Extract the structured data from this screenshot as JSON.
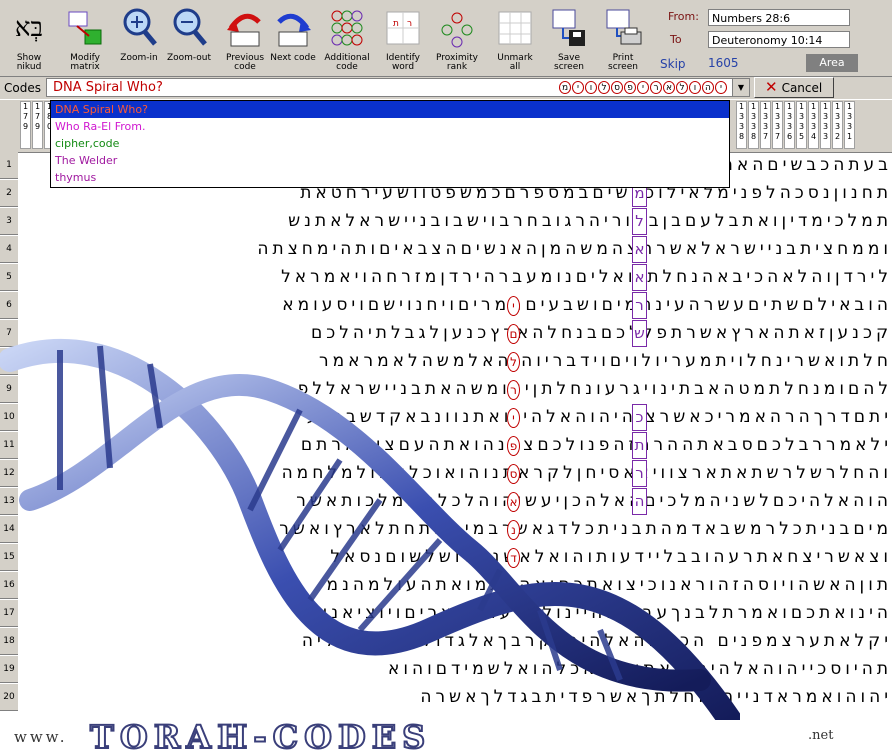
{
  "toolbar": {
    "buttons": [
      {
        "label": "Show nikud",
        "icon": "hebrew-bet-aleph-icon"
      },
      {
        "label": "Modify matrix",
        "icon": "matrix-grid-icon"
      },
      {
        "label": "Zoom-in",
        "icon": "zoom-in-icon"
      },
      {
        "label": "Zoom-out",
        "icon": "zoom-out-icon"
      },
      {
        "label": "Previous code",
        "icon": "previous-arrow-icon"
      },
      {
        "label": "Next code",
        "icon": "next-arrow-icon"
      },
      {
        "label": "Additional code",
        "icon": "additional-code-icon"
      },
      {
        "label": "Identify word",
        "icon": "identify-word-icon"
      },
      {
        "label": "Proximity rank",
        "icon": "proximity-rank-icon"
      },
      {
        "label": "Unmark all",
        "icon": "unmark-icon"
      },
      {
        "label": "Save screen",
        "icon": "floppy-disk-icon"
      },
      {
        "label": "Print screen",
        "icon": "printer-icon"
      }
    ],
    "bet_aleph": "בְּא",
    "range": {
      "from_label": "From:",
      "from_value": "Numbers 28:6",
      "to_label": "To",
      "to_value": "Deuteronomy 10:14"
    },
    "skip_label": "Skip",
    "skip_value": "1605",
    "area_label": "Area"
  },
  "codes": {
    "label": "Codes :",
    "selected": "DNA Spiral Who?",
    "oval_letters": [
      "מ",
      "י",
      "ו",
      "ל",
      "ס",
      "פ",
      "י",
      "ר",
      "א",
      "ל",
      "ו",
      "ה",
      "י"
    ],
    "cancel_label": "Cancel",
    "dropdown": [
      {
        "text": "DNA Spiral Who?",
        "color": "#ff5a32"
      },
      {
        "text": "Who Ra-El From.",
        "color": "#d017d0"
      },
      {
        "text": "cipher,code",
        "color": "#138a13"
      },
      {
        "text": "The Welder",
        "color": "#a019a0"
      },
      {
        "text": "thymus",
        "color": "#a019a0"
      }
    ]
  },
  "ruler": {
    "columns": [
      [
        "1",
        "7",
        "9"
      ],
      [
        "1",
        "7",
        "9"
      ],
      [
        "1",
        "8",
        "0"
      ],
      [
        "1",
        "3",
        "3",
        "8"
      ],
      [
        "1",
        "3",
        "3",
        "8"
      ],
      [
        "1",
        "3",
        "3",
        "7"
      ],
      [
        "1",
        "3",
        "3",
        "7"
      ],
      [
        "1",
        "3",
        "3",
        "6"
      ],
      [
        "1",
        "3",
        "3",
        "5"
      ],
      [
        "1",
        "3",
        "3",
        "4"
      ],
      [
        "1",
        "3",
        "3",
        "3"
      ],
      [
        "1",
        "3",
        "3",
        "2"
      ],
      [
        "1",
        "3",
        "3",
        "1"
      ]
    ]
  },
  "rows": [
    {
      "n": "1",
      "text": "בעתהכבשיםהאחדביוםהשביעילשבעתימיםשבעתהכבשים"
    },
    {
      "n": "2",
      "text": "תחנוןנסכהלפנימלאילוכלשיםבמספרםכמשפטוושעירחטאת"
    },
    {
      "n": "3",
      "text": "תמלכימדיןואתבלעםבןבעוריהרגובחרבוישבובניישראלאתנש"
    },
    {
      "n": "4",
      "text": "וממחציתבניישראלאשרחצהמשהמןהאנשיםהצבאיםותהימחצתה"
    },
    {
      "n": "5",
      "text": "לירדןוהלאהכיבאהנחלתנואליםנומעברהירדןמזרחהויאמראל"
    },
    {
      "n": "6",
      "text": "הובאילםשתיםעשרהעינתמיםושבעיםתמריםויחנוישםויסעומא"
    },
    {
      "n": "7",
      "text": "קכנעןזאתהארץאשרתפללכםבנחלהארץכנעןלגבלתיהלכם"
    },
    {
      "n": "8",
      "text": "חלתואשרינחלויתמעריולויםוידבריוהוהאלמשהלאמראמר"
    },
    {
      "n": "9",
      "text": "להםומנחלתמטהאבתינויגרעונחלתןיצומשהאתבניישראללפ"
    },
    {
      "n": "10",
      "text": "יתםדרךהרהאמריכאשרצוהיהוהאלהינואתנוונבאקדשברנע"
    },
    {
      "n": "11",
      "text": "ילאמררבלכםסבאתההרהזהפנולכםצפנהואתהעםצואמרתם"
    },
    {
      "n": "12",
      "text": "והחלרשלרשתאתארצוויצאסיחןלקראתנוהואוכלעמולמלחמה"
    },
    {
      "n": "13",
      "text": "הוהאלהיכםלשניהמלכיםהאלהכןיעשיהוהלכלהממלכותאשר"
    },
    {
      "n": "14",
      "text": "מיםבניתכלרמשבאדמהתבניתכלדגאשרבמיםמתחתלארץואשר"
    },
    {
      "n": "15",
      "text": "וצאשריצחאתרעהובבליידעותוהואלאשנאלושלשוםנסאל"
    },
    {
      "n": "16",
      "text": "תוןהאשהויוסהזהוראנוכיצואתכםואהבתמואתהעולמהנמ"
    },
    {
      "n": "17",
      "text": "הינואתכםואמרתלבנךעבדיםהיינולפרעהבמצריםויוציאנויה"
    },
    {
      "n": "18",
      "text": "יקלאתערצמפנים הכיהוהאלהיךבקרבךאלגדולנוראונשליה"
    },
    {
      "n": "19",
      "text": "תהיוסכייהוהאלהיךהואתאשראכלהואלשמידםוהוא"
    },
    {
      "n": "20",
      "text": "יהוהואמראדנייהוהחלתךאשרפדיתבגדלךאשרה"
    }
  ],
  "column_letters": [
    "מ",
    "ל",
    "א",
    "א",
    "א",
    "ר",
    "ש",
    "",
    "",
    "כ",
    "ת",
    "ר",
    "ה"
  ],
  "spiral_letters": [
    "י",
    "ם",
    "ל",
    "ר",
    "י",
    "פ",
    "ס",
    "א",
    "נ",
    "ד"
  ],
  "footer": {
    "prefix": "www.",
    "brand": "TORAH-CODES",
    "suffix": ".net"
  }
}
